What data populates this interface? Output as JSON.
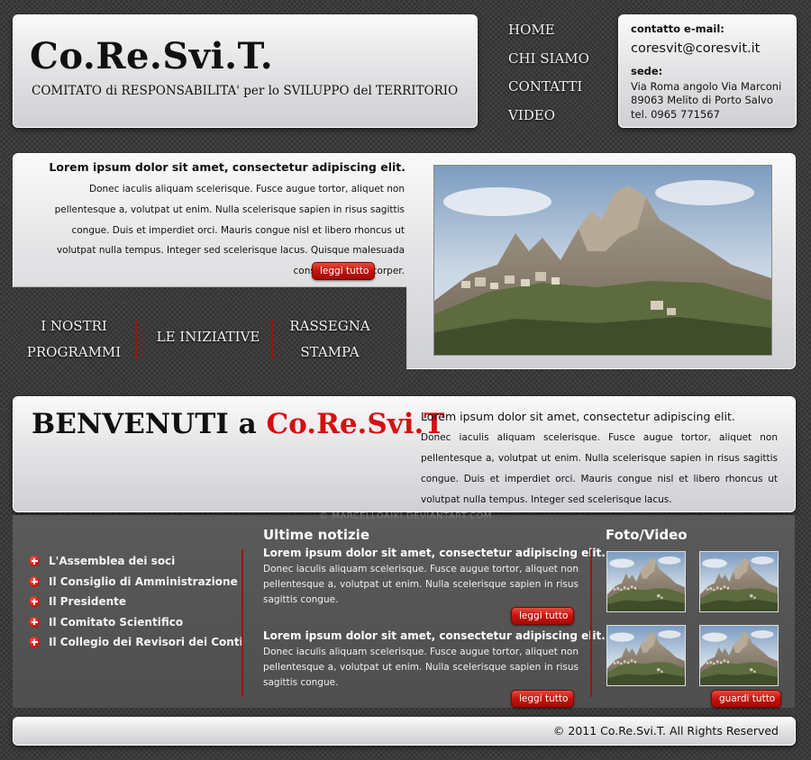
{
  "header": {
    "site_title": "Co.Re.Svi.T.",
    "site_subtitle": "COMITATO di RESPONSABILITA' per lo SVILUPPO del TERRITORIO"
  },
  "nav": {
    "items": [
      "HOME",
      "CHI SIAMO",
      "CONTATTI",
      "VIDEO"
    ]
  },
  "contact": {
    "email_label": "contatto e-mail:",
    "email": "coresvit@coresvit.it",
    "sede_label": "sede:",
    "address_1": "Via Roma angolo Via Marconi",
    "address_2": "89063 Melito di Porto Salvo",
    "phone": "tel. 0965 771567"
  },
  "feature": {
    "heading": "Lorem ipsum dolor sit amet, consectetur adipiscing elit.",
    "text": "Donec iaculis aliquam scelerisque. Fusce augue tortor, aliquet non pellentesque a, volutpat ut enim. Nulla scelerisque sapien in risus sagittis congue. Duis et imperdiet orci. Mauris congue nisl et libero rhoncus ut volutpat nulla tempus. Integer sed scelerisque lacus. Quisque malesuada consequat ullamcorper.",
    "more_label": "leggi tutto"
  },
  "subnav": {
    "item_1_line_1": "I NOSTRI",
    "item_1_line_2": "PROGRAMMI",
    "item_2": "LE INIZIATIVE",
    "item_3_line_1": "RASSEGNA",
    "item_3_line_2": "STAMPA"
  },
  "welcome": {
    "title_prefix": "BENVENUTI a ",
    "title_accent": "Co.Re.Svi.T",
    "heading": "Lorem ipsum dolor sit amet, consectetur adipiscing elit.",
    "text": "Donec iaculis aliquam scelerisque. Fusce augue tortor, aliquet non pellentesque a, volutpat ut enim. Nulla scelerisque sapien in risus sagittis congue. Duis et imperdiet orci. Mauris congue nisl et libero rhoncus ut volutpat nulla tempus. Integer sed scelerisque lacus."
  },
  "watermark": "© MARCELLOAIKI.DEVIANTART.COM",
  "links": {
    "items": [
      "L'Assemblea dei soci",
      "Il Consiglio di Amministrazione",
      "Il Presidente",
      "Il Comitato Scientifico",
      "Il Collegio dei Revisori dei Conti"
    ]
  },
  "news": {
    "title": "Ultime notizie",
    "item_1_heading": "Lorem ipsum dolor sit amet, consectetur adipiscing elit.",
    "item_1_text": "Donec iaculis aliquam scelerisque. Fusce augue tortor, aliquet non pellentesque a, volutpat ut enim. Nulla scelerisque sapien in risus sagittis congue.",
    "item_1_more": "leggi tutto",
    "item_2_heading": "Lorem ipsum dolor sit amet, consectetur adipiscing elit.",
    "item_2_text": "Donec iaculis aliquam scelerisque. Fusce augue tortor, aliquet non pellentesque a, volutpat ut enim. Nulla scelerisque sapien in risus sagittis congue.",
    "item_2_more": "leggi tutto"
  },
  "media": {
    "title": "Foto/Video",
    "more_label": "guardi tutto"
  },
  "footer": {
    "copyright": "© 2011 Co.Re.Svi.T. All Rights Reserved"
  },
  "colors": {
    "accent_red": "#d41010",
    "button_red": "#c4140c",
    "background": "#3a3a3a"
  }
}
